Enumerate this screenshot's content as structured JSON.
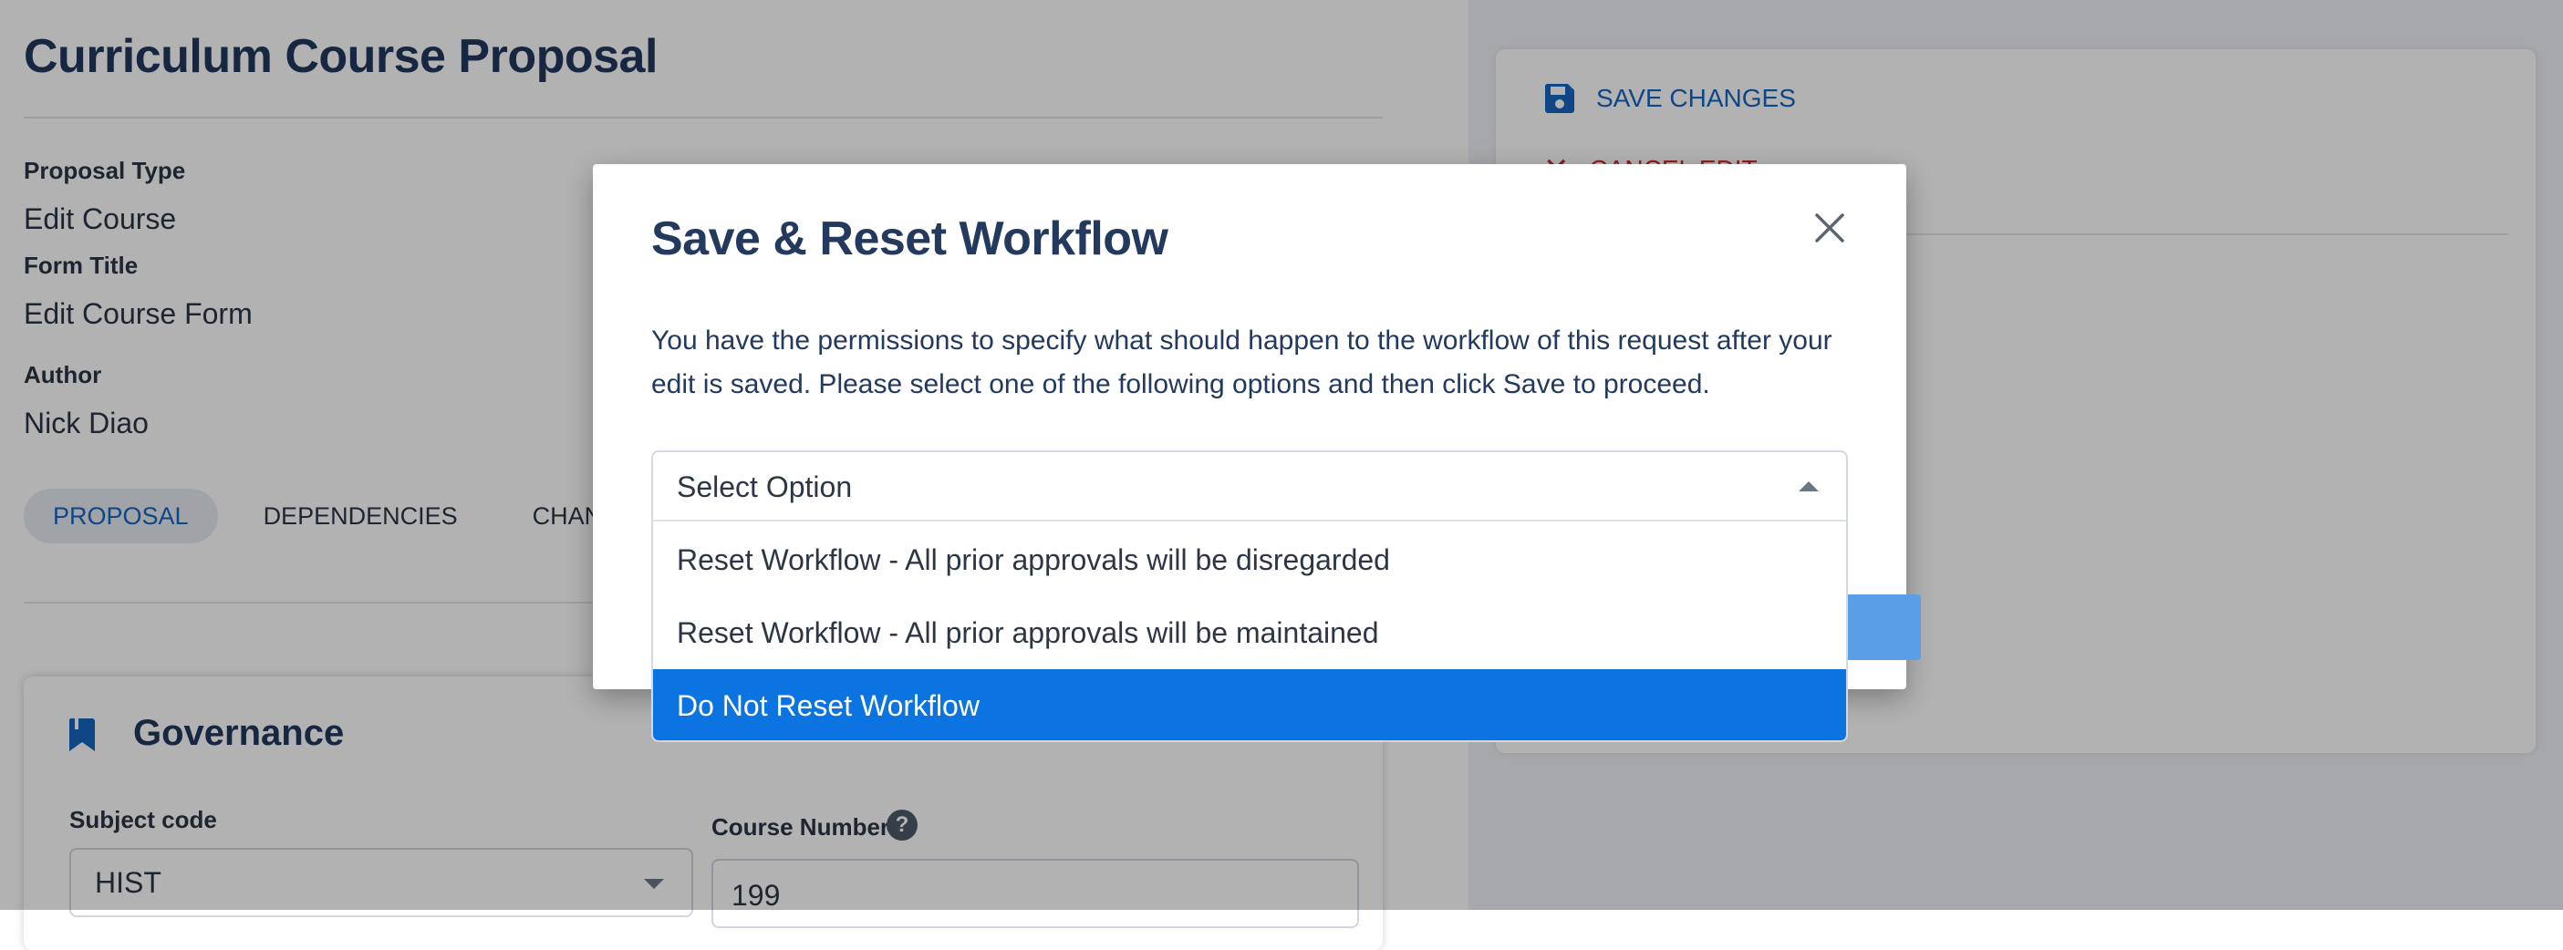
{
  "page": {
    "title": "Curriculum Course Proposal",
    "proposal_type_label": "Proposal Type",
    "proposal_type_value": "Edit Course",
    "form_title_label": "Form Title",
    "form_title_value": "Edit Course Form",
    "author_label": "Author",
    "author_value": "Nick Diao"
  },
  "tabs": [
    {
      "label": "PROPOSAL"
    },
    {
      "label": "DEPENDENCIES"
    },
    {
      "label": "CHAN"
    }
  ],
  "governance": {
    "title": "Governance",
    "subject_code_label": "Subject code",
    "subject_code_value": "HIST",
    "course_number_label": "Course Number",
    "course_number_value": "199"
  },
  "actions": {
    "save_label": "SAVE CHANGES",
    "cancel_label": "CANCEL EDIT"
  },
  "modal": {
    "title": "Save & Reset Workflow",
    "message": "You have the permissions to specify what should happen to the workflow of this request after your edit is saved. Please select one of the following options and then click Save to proceed.",
    "select_placeholder": "Select Option",
    "options": [
      {
        "label": "Reset Workflow - All prior approvals will be disregarded"
      },
      {
        "label": "Reset Workflow - All prior approvals will be maintained"
      },
      {
        "label": "Do Not Reset Workflow"
      }
    ],
    "highlighted_option": "Do Not Reset Workflow"
  },
  "colors": {
    "accent_blue": "#1665c1",
    "danger_red": "#cc2a2a",
    "highlight": "#0b74e0",
    "heading": "#23395d"
  },
  "icons": {
    "save": "floppy-disk-icon",
    "cancel": "close-icon",
    "governance": "bookmark-icon",
    "help": "question-circle-icon"
  }
}
